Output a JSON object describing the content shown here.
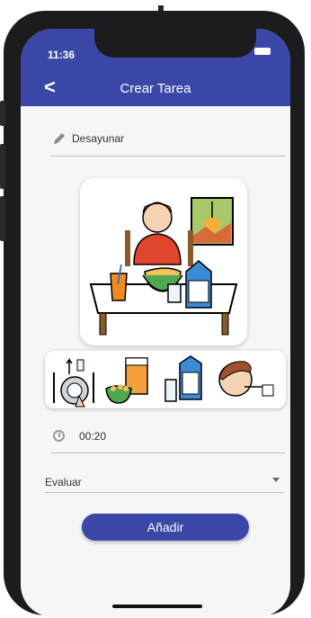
{
  "status_bar": {
    "time": "11:36",
    "dots": "...."
  },
  "appbar": {
    "back_glyph": "<",
    "title": "Crear Tarea"
  },
  "form": {
    "name_icon": "pencil-icon",
    "name_value": "Desayunar",
    "duration_icon": "clock-icon",
    "duration_value": "00:20",
    "evaluate_label": "Evaluar",
    "evaluate_icon": "dropdown-arrow-icon",
    "add_label": "Añadir"
  },
  "images": {
    "main": "breakfast-scene-pictogram",
    "steps": [
      "set-table-pictogram",
      "cereal-pictogram",
      "milk-pictogram",
      "eating-pictogram"
    ]
  },
  "colors": {
    "accent": "#3b47a6",
    "background": "#f6f6f7"
  }
}
